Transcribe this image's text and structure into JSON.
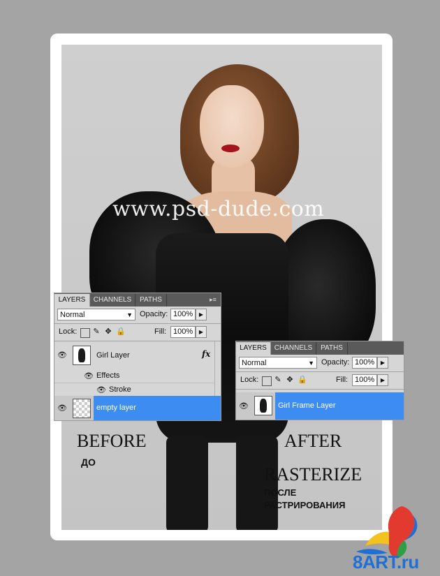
{
  "watermark": "www.psd-dude.com",
  "captions": {
    "before": "BEFORE",
    "before_ru": "ДО",
    "after": "AFTER",
    "rasterize": "RASTERIZE",
    "after_ru_line1": "ПОСЛЕ",
    "after_ru_line2": "РАСТРИРОВАНИЯ"
  },
  "panel_before": {
    "tabs": [
      "LAYERS",
      "CHANNELS",
      "PATHS"
    ],
    "blend_mode": "Normal",
    "opacity_label": "Opacity:",
    "opacity_value": "100%",
    "lock_label": "Lock:",
    "fill_label": "Fill:",
    "fill_value": "100%",
    "layers": [
      {
        "name": "Girl Layer",
        "fx": "fx"
      },
      {
        "name": "Effects"
      },
      {
        "name": "Stroke"
      },
      {
        "name": "empty layer",
        "selected": true
      }
    ]
  },
  "panel_after": {
    "tabs": [
      "LAYERS",
      "CHANNELS",
      "PATHS"
    ],
    "blend_mode": "Normal",
    "opacity_label": "Opacity:",
    "opacity_value": "100%",
    "lock_label": "Lock:",
    "fill_label": "Fill:",
    "fill_value": "100%",
    "layers": [
      {
        "name": "Girl Frame Layer",
        "selected": true
      }
    ]
  },
  "logo": {
    "text": "8ART.ru"
  },
  "colors": {
    "selection": "#3d8cf2",
    "logo": "#1e6fd6",
    "background": "#a4a4a4"
  }
}
